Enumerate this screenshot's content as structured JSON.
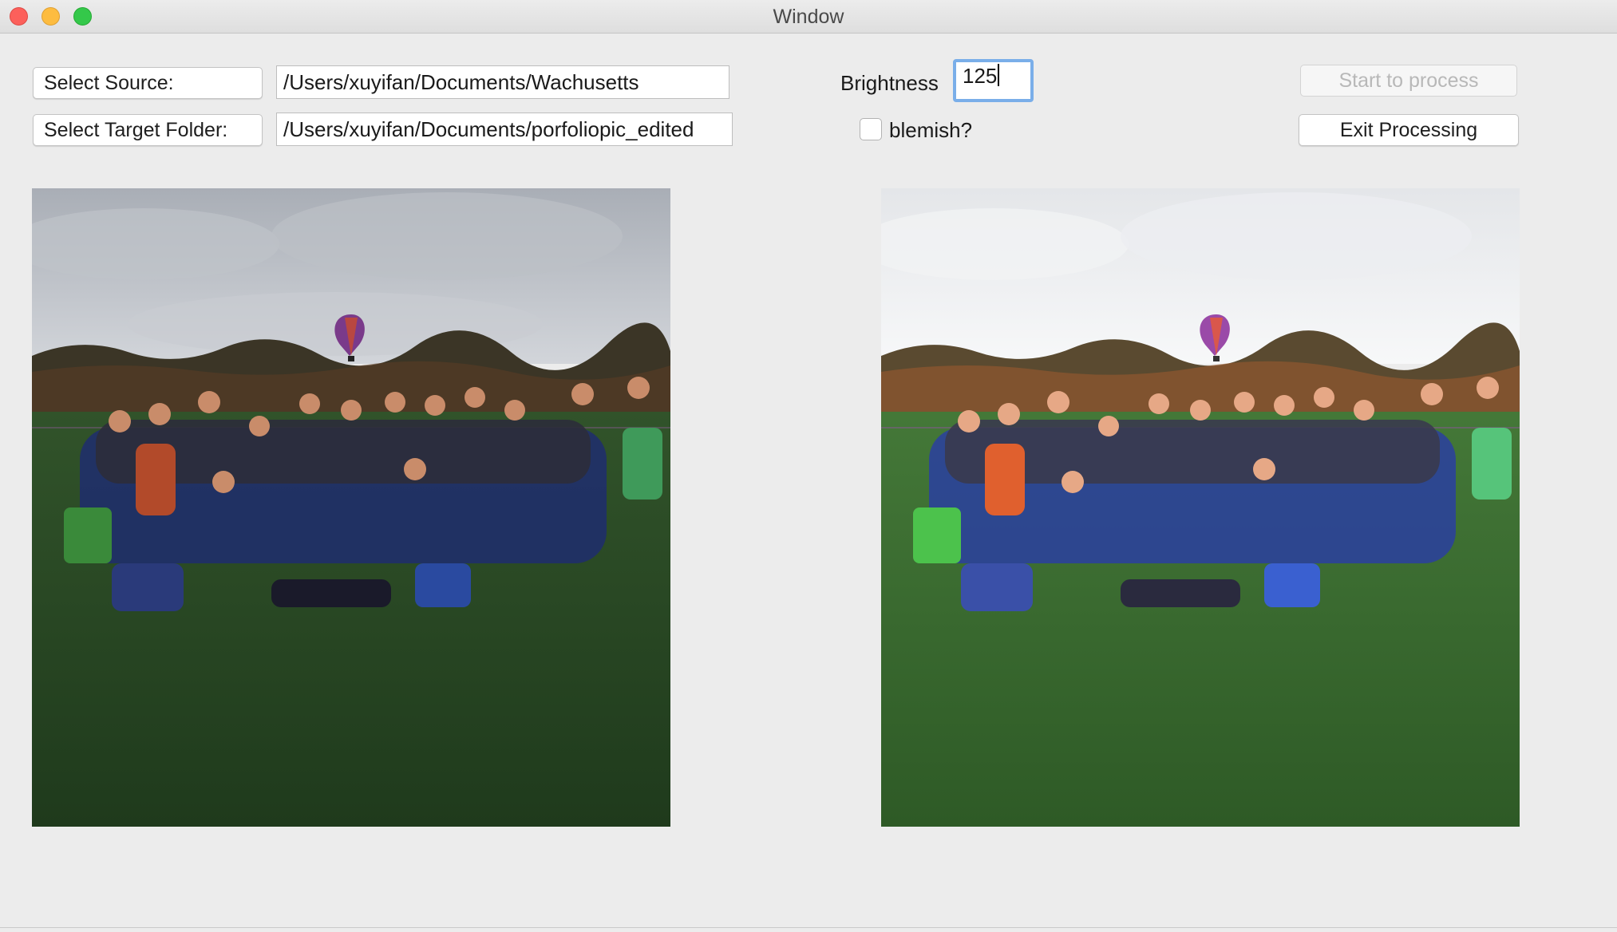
{
  "window": {
    "title": "Window"
  },
  "source": {
    "button_label": "Select Source:",
    "path": "/Users/xuyifan/Documents/Wachusetts"
  },
  "target": {
    "button_label": "Select Target Folder:",
    "path": "/Users/xuyifan/Documents/porfoliopic_edited"
  },
  "brightness": {
    "label": "Brightness",
    "value": "125"
  },
  "blemish": {
    "label": "blemish?",
    "checked": false
  },
  "actions": {
    "start_label": "Start to process",
    "start_enabled": false,
    "exit_label": "Exit Processing"
  },
  "images": [
    {
      "role": "original",
      "sky": "#c3c7cd",
      "grass": "#2c4d25"
    },
    {
      "role": "processed",
      "sky": "#eef0f2",
      "grass": "#3d6e30"
    }
  ]
}
